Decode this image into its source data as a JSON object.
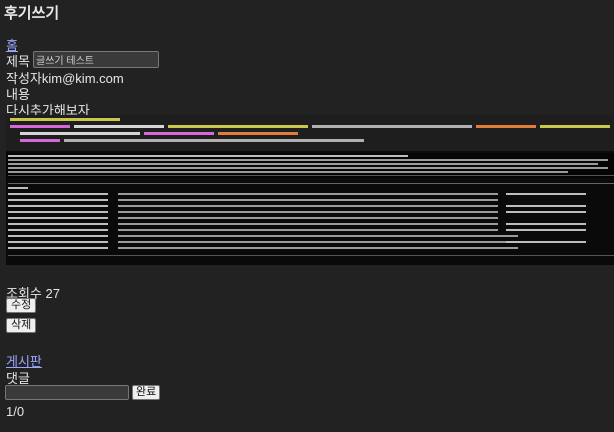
{
  "page": {
    "title": "후기쓰기"
  },
  "nav": {
    "home_link": "홈",
    "board_link": "게시판"
  },
  "post": {
    "title_label": "제목",
    "title_value": "글쓰기 테스트",
    "author_label": "작성자",
    "author_value": "kim@kim.com",
    "content_label": "내용",
    "content_text": "다시추가해보자",
    "views_label": "조회수",
    "views_value": "27"
  },
  "actions": {
    "edit_label": "수정",
    "delete_label": "삭제"
  },
  "comments": {
    "label": "댓글",
    "submit_label": "완료",
    "pagination": "1/0"
  },
  "colors": {
    "background": "#222222",
    "link": "#9aa6ff",
    "code_keyword": "#d46ad8",
    "code_annotation": "#c8c84a",
    "code_string": "#e07b3a"
  }
}
